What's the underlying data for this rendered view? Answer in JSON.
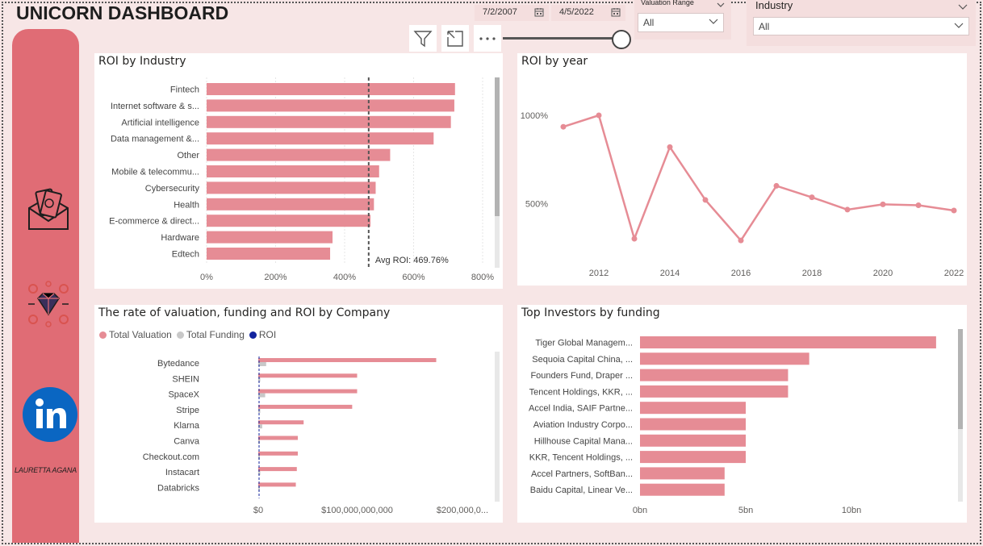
{
  "header": {
    "title": "UNICORN DASHBOARD",
    "start_date": "7/2/2007",
    "end_date": "4/5/2022"
  },
  "sidebar": {
    "author": "LAURETTA AGANA",
    "icons": [
      "money-envelope-icon",
      "diamond-network-icon",
      "linkedin-icon"
    ]
  },
  "slicers": {
    "valuation_range": {
      "label": "Valuation Range",
      "value": "All"
    },
    "industry": {
      "label": "Industry",
      "value": "All"
    }
  },
  "colors": {
    "accent": "#e06c75",
    "bar": "#e68c95",
    "funding": "#c8c8c8",
    "roi": "#12239e",
    "background": "#f7e6e6"
  },
  "chart_data": [
    {
      "type": "bar",
      "orientation": "horizontal",
      "title": "ROI by Industry",
      "categories": [
        "Fintech",
        "Internet software & s...",
        "Artificial intelligence",
        "Data management &...",
        "Other",
        "Mobile & telecommu...",
        "Cybersecurity",
        "Health",
        "E-commerce & direct...",
        "Hardware",
        "Edtech"
      ],
      "values": [
        720,
        718,
        708,
        658,
        532,
        500,
        490,
        485,
        475,
        365,
        358
      ],
      "unit": "%",
      "xticks": [
        "0%",
        "200%",
        "400%",
        "600%",
        "800%"
      ],
      "xlim": [
        0,
        800
      ],
      "reference_line": {
        "label": "Avg ROI: 469.76%",
        "value": 469.76
      },
      "grid": true
    },
    {
      "type": "line",
      "title": "ROI by year",
      "x": [
        2011,
        2012,
        2013,
        2014,
        2015,
        2016,
        2017,
        2018,
        2019,
        2020,
        2021,
        2022
      ],
      "values": [
        935,
        1000,
        300,
        820,
        520,
        290,
        600,
        535,
        465,
        495,
        490,
        460
      ],
      "xticks": [
        "2012",
        "2014",
        "2016",
        "2018",
        "2020",
        "2022"
      ],
      "yticks": [
        "500%",
        "1000%"
      ],
      "grid": false
    },
    {
      "type": "bar",
      "orientation": "horizontal",
      "title": "The rate of valuation, funding and ROI by Company",
      "categories": [
        "Bytedance",
        "SHEIN",
        "SpaceX",
        "Stripe",
        "Klarna",
        "Canva",
        "Checkout.com",
        "Instacart",
        "Databricks"
      ],
      "series": [
        {
          "name": "Total Valuation",
          "values": [
            180000000000,
            100000000000,
            100000000000,
            95000000000,
            45900000000,
            40000000000,
            40000000000,
            39000000000,
            38000000000
          ]
        },
        {
          "name": "Total Funding",
          "values": [
            8000000000,
            2000000000,
            7000000000,
            2000000000,
            4000000000,
            1000000000,
            1000000000,
            2000000000,
            1000000000
          ]
        },
        {
          "name": "ROI",
          "values": [
            1,
            1,
            1,
            1,
            1,
            1,
            1,
            1,
            1
          ]
        }
      ],
      "xticks": [
        "$0",
        "$100,000,000,000",
        "$200,000,0..."
      ],
      "xlim": [
        0,
        220000000000
      ],
      "legend": "top-left"
    },
    {
      "type": "bar",
      "orientation": "horizontal",
      "title": "Top Investors by funding",
      "categories": [
        "Tiger Global Managem...",
        "Sequoia Capital China, ...",
        "Founders Fund, Draper ...",
        "Tencent Holdings, KKR, ...",
        "Accel India, SAIF Partne...",
        "Aviation Industry Corpo...",
        "Hillhouse Capital Mana...",
        "KKR, Tencent Holdings, ...",
        "Accel Partners, SoftBan...",
        "Baidu Capital, Linear Ve..."
      ],
      "values": [
        14,
        8,
        7,
        7,
        5,
        5,
        5,
        5,
        4,
        4
      ],
      "unit": "bn",
      "xticks": [
        "0bn",
        "5bn",
        "10bn"
      ],
      "xlim": [
        0,
        14.5
      ]
    }
  ]
}
